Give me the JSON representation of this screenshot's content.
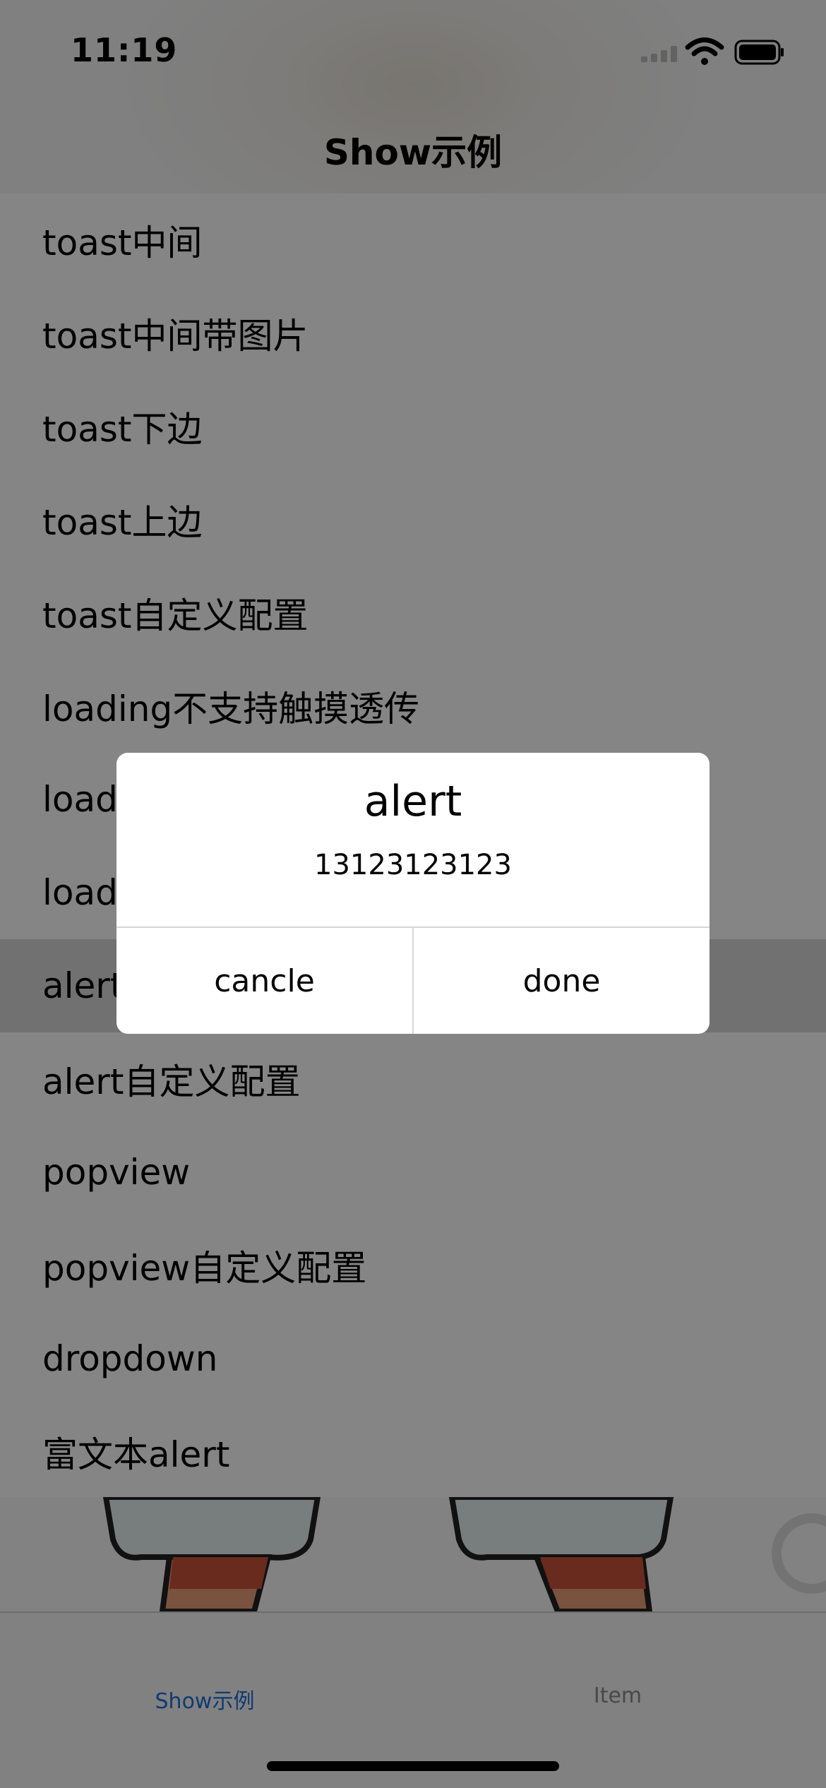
{
  "status_bar": {
    "time": "11:19"
  },
  "nav": {
    "title": "Show示例"
  },
  "list": {
    "items": [
      "toast中间",
      "toast中间带图片",
      "toast下边",
      "toast上边",
      "toast自定义配置",
      "loading不支持触摸透传",
      "loadi",
      "loadi",
      "alert",
      "alert自定义配置",
      "popview",
      "popview自定义配置",
      "dropdown",
      "富文本alert"
    ]
  },
  "tabs": {
    "show": "Show示例",
    "item": "Item"
  },
  "alert": {
    "title": "alert",
    "message": "13123123123",
    "cancel_label": "cancle",
    "done_label": "done"
  },
  "colors": {
    "accent": "#1e6fd9",
    "overlay": "rgba(0,0,0,0.48)"
  }
}
